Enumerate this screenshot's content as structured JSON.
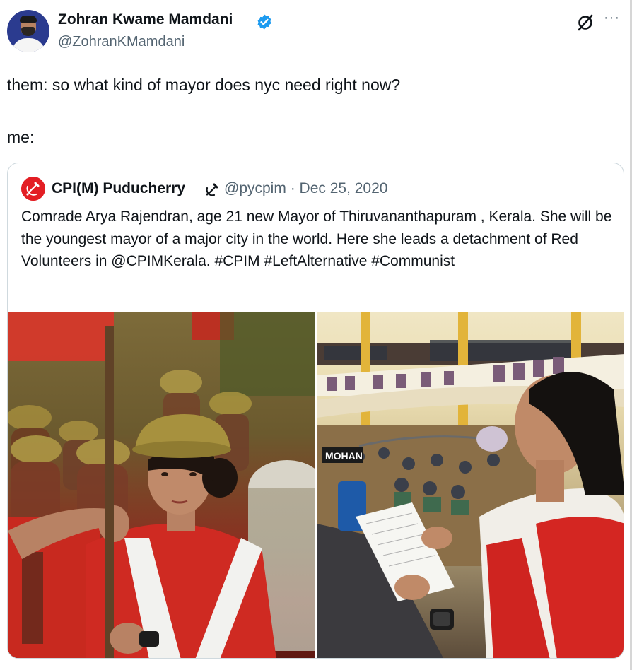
{
  "author": {
    "name": "Zohran Kwame Mamdani",
    "handle": "@ZohranKMamdani",
    "verified_icon": "verified-badge-icon",
    "accent": "#1d9bf0"
  },
  "actions": {
    "grok_icon": "grok-icon",
    "more_label": "···"
  },
  "tweet": {
    "text": "them: so what kind of mayor does nyc need right now?\n\nme:"
  },
  "quote": {
    "name": "CPI(M) Puducherry",
    "name_icon": "hammer-sickle-icon",
    "handle": "@pycpim",
    "separator": "·",
    "date": "Dec 25, 2020",
    "text": "Comrade Arya Rajendran, age 21  new Mayor of Thiruvananthapuram , Kerala. She will be the youngest mayor of a major city in the world. Here she leads a detachment of Red Volunteers in @CPIMKerala. #CPIM  #LeftAlternative #Communist",
    "brand_color": "#e31e24"
  },
  "media": {
    "left_photo": "woman-in-red-uniform-holding-flag-photo",
    "right_photo": "woman-reading-speech-at-podium-photo",
    "nameplate": "MOHAN"
  }
}
